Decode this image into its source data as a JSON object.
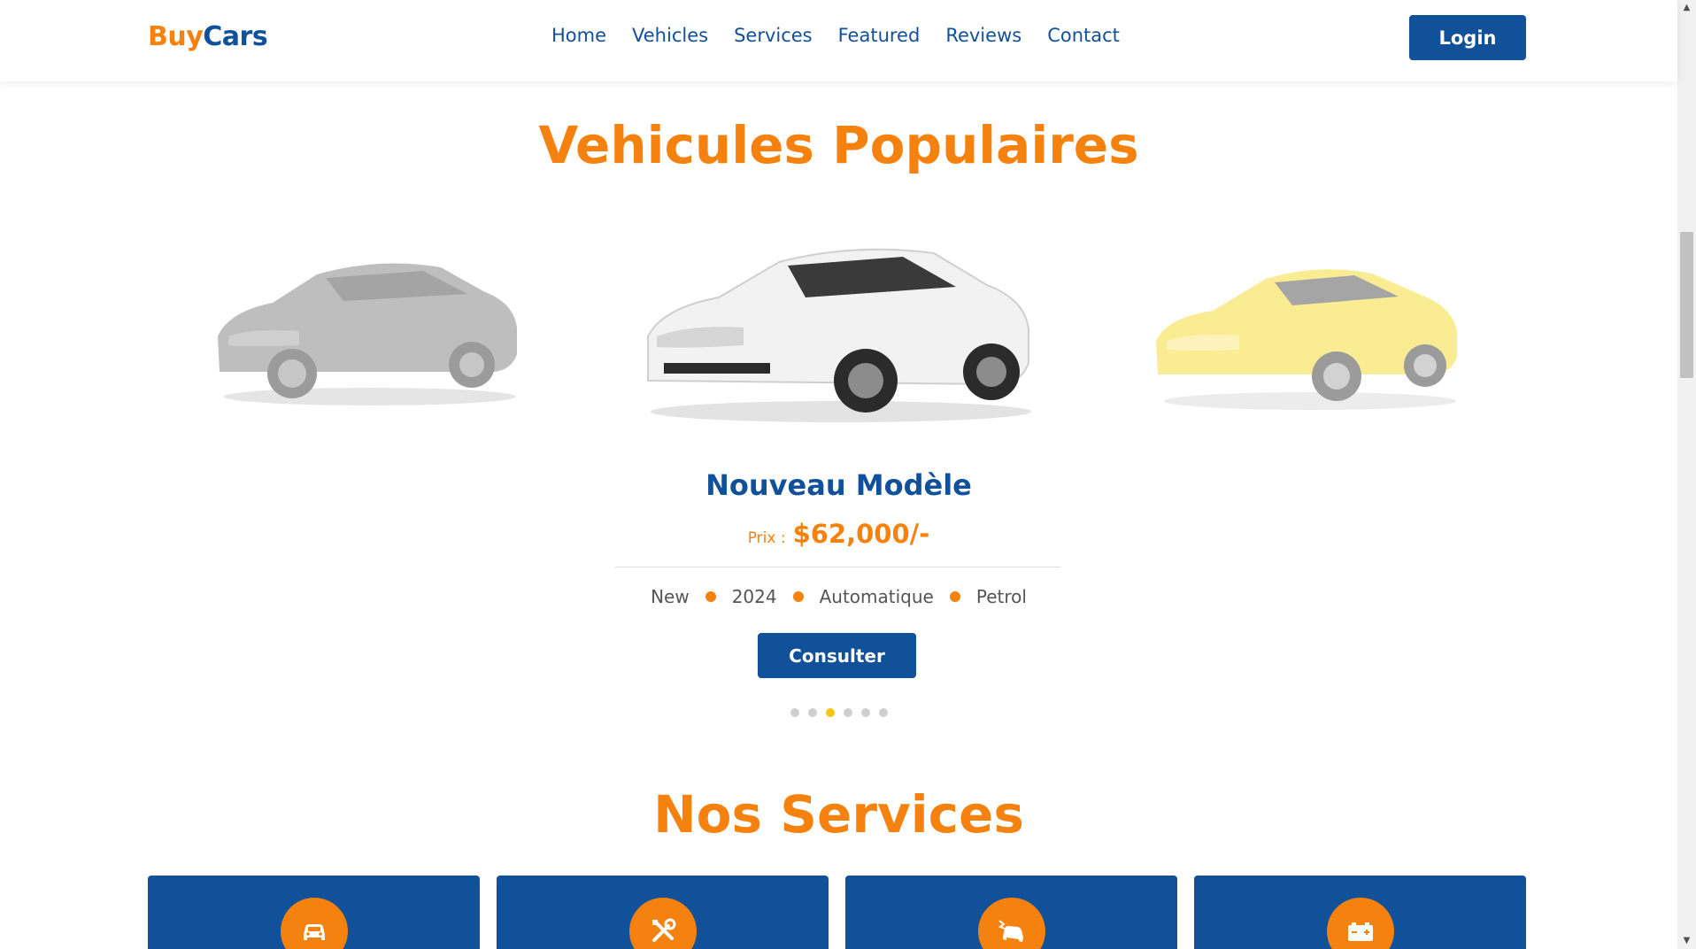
{
  "header": {
    "logo_part1": "Buy",
    "logo_part2": "Cars",
    "nav": [
      "Home",
      "Vehicles",
      "Services",
      "Featured",
      "Reviews",
      "Contact"
    ],
    "login_label": "Login"
  },
  "popular": {
    "title": "Vehicules Populaires",
    "model_name": "Nouveau Modèle",
    "price_label": "Prix :",
    "price_value": "$62,000/-",
    "specs": [
      "New",
      "2024",
      "Automatique",
      "Petrol"
    ],
    "consult_label": "Consulter",
    "pager": {
      "count": 6,
      "active_index": 2
    }
  },
  "services": {
    "title": "Nos Services",
    "icons": [
      "car-icon",
      "tools-icon",
      "car-crash-icon",
      "battery-icon"
    ]
  },
  "colors": {
    "brand_orange": "#f5820f",
    "brand_blue": "#11519a",
    "pager_active": "#f5c518"
  }
}
